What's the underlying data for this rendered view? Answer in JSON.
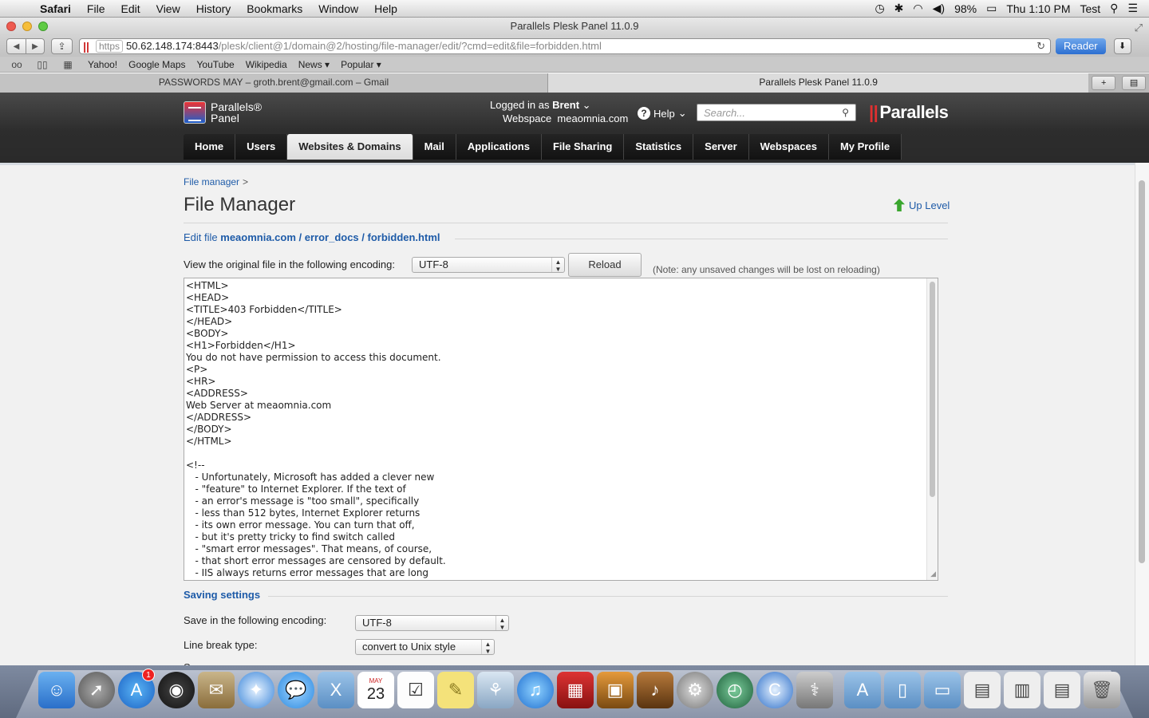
{
  "menubar": {
    "app": "Safari",
    "items": [
      "File",
      "Edit",
      "View",
      "History",
      "Bookmarks",
      "Window",
      "Help"
    ],
    "battery": "98%",
    "clock": "Thu 1:10 PM",
    "user": "Test"
  },
  "window": {
    "title": "Parallels Plesk Panel 11.0.9"
  },
  "toolbar": {
    "url_protocol": "https",
    "url_host": "50.62.148.174:8443",
    "url_path": "/plesk/client@1/domain@2/hosting/file-manager/edit/?cmd=edit&file=forbidden.html",
    "reader_label": "Reader"
  },
  "bookmarks": [
    "Yahoo!",
    "Google Maps",
    "YouTube",
    "Wikipedia",
    "News ▾",
    "Popular ▾"
  ],
  "tabs": [
    {
      "label": "PASSWORDS MAY – groth.brent@gmail.com – Gmail"
    },
    {
      "label": "Parallels Plesk Panel 11.0.9"
    }
  ],
  "plesk": {
    "logo_line1": "Parallels®",
    "logo_line2": "Panel",
    "logged_in_prefix": "Logged in as",
    "logged_in_user": "Brent",
    "webspace_prefix": "Webspace",
    "webspace_name": "meaomnia.com",
    "help_label": "Help",
    "search_placeholder": "Search...",
    "brand": "Parallels",
    "nav": [
      "Home",
      "Users",
      "Websites & Domains",
      "Mail",
      "Applications",
      "File Sharing",
      "Statistics",
      "Server",
      "Webspaces",
      "My Profile"
    ],
    "active_nav": "Websites & Domains"
  },
  "page": {
    "breadcrumb": "File manager",
    "title": "File Manager",
    "up_level": "Up Level",
    "edit_file_prefix": "Edit file",
    "edit_file_path": "meaomnia.com / error_docs / forbidden.html",
    "encoding_label": "View the original file in the following encoding:",
    "encoding_value": "UTF-8",
    "reload_label": "Reload",
    "reload_note": "(Note: any unsaved changes will be lost on reloading)",
    "file_content": "<HTML>\n<HEAD>\n<TITLE>403 Forbidden</TITLE>\n</HEAD>\n<BODY>\n<H1>Forbidden</H1>\nYou do not have permission to access this document.\n<P>\n<HR>\n<ADDRESS>\nWeb Server at meaomnia.com\n</ADDRESS>\n</BODY>\n</HTML>\n\n<!--\n   - Unfortunately, Microsoft has added a clever new\n   - \"feature\" to Internet Explorer. If the text of\n   - an error's message is \"too small\", specifically\n   - less than 512 bytes, Internet Explorer returns\n   - its own error message. You can turn that off,\n   - but it's pretty tricky to find switch called\n   - \"smart error messages\". That means, of course,\n   - that short error messages are censored by default.\n   - IIS always returns error messages that are long",
    "saving_settings": "Saving settings",
    "save_encoding_label": "Save in the following encoding:",
    "save_encoding_value": "UTF-8",
    "line_break_label": "Line break type:",
    "line_break_value": "convert to Unix style",
    "cutoff_text": "S"
  },
  "dock": {
    "icons": [
      "finder-icon",
      "launchpad-icon",
      "app-store-icon",
      "dashboard-icon",
      "mail-icon",
      "safari-icon",
      "messages-icon",
      "folder-icon",
      "calendar-icon",
      "reminders-icon",
      "notes-icon",
      "photos-icon",
      "itunes-icon",
      "photo-booth-icon",
      "iphoto-icon",
      "garageband-icon",
      "system-preferences-icon",
      "time-machine-icon",
      "cleanup-icon",
      "disk-utility-icon",
      "applications-folder-icon",
      "documents-folder-icon",
      "downloads-folder-icon",
      "window-icon-1",
      "window-icon-2",
      "window-icon-3",
      "trash-icon"
    ],
    "app_store_badge": "1",
    "calendar_month": "MAY",
    "calendar_day": "23"
  }
}
